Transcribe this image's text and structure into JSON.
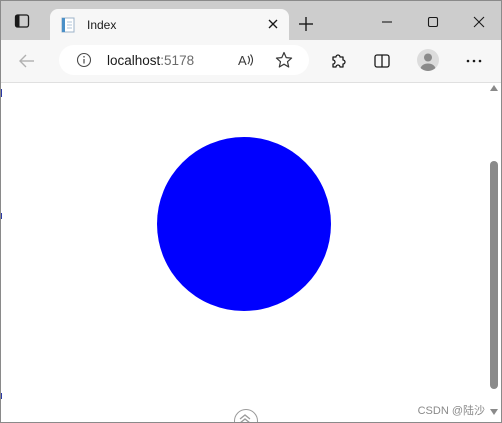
{
  "tab": {
    "title": "Index",
    "close_glyph": "✕"
  },
  "new_tab": {
    "glyph": "+"
  },
  "window_controls": {
    "minimize_glyph": "—",
    "maximize_glyph": "☐",
    "close_glyph": "✕"
  },
  "address_bar": {
    "host": "localhost",
    "port": ":5178",
    "read_aloud_glyph": "Aᴬ"
  },
  "page": {
    "shape": "circle",
    "fill_color": "#0000ff"
  },
  "scrollbar": {
    "thumb_color": "#8a8a8a"
  },
  "watermark": {
    "text": "CSDN @陆沙"
  },
  "icons": {
    "tab_actions": "tab-actions-icon",
    "favicon": "page-favicon-icon",
    "back": "back-arrow-icon",
    "info": "info-icon",
    "favorite": "star-icon",
    "extensions": "extensions-puzzle-icon",
    "split_screen": "split-screen-icon",
    "profile": "profile-avatar-icon",
    "more": "more-dots-icon"
  }
}
